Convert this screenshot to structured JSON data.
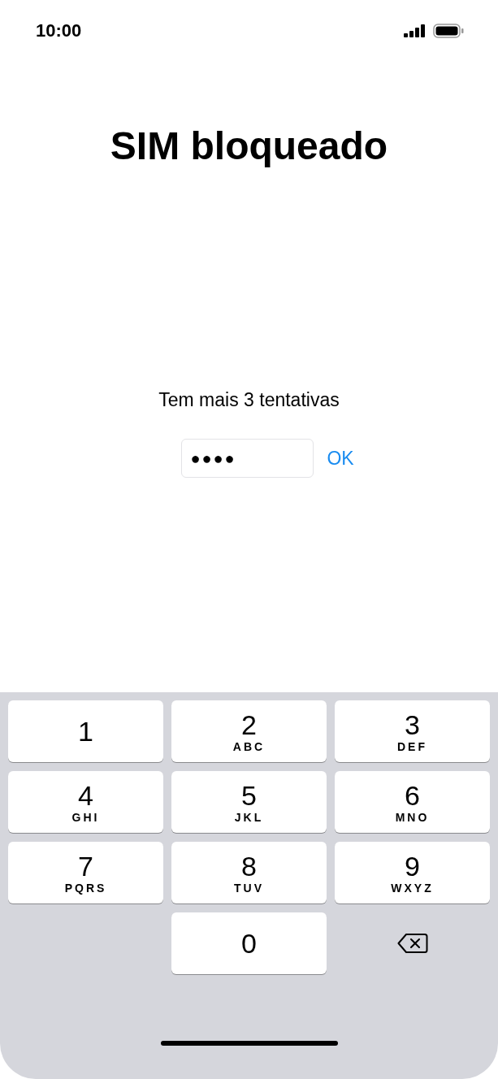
{
  "status_bar": {
    "time": "10:00"
  },
  "title": "SIM bloqueado",
  "message": "Tem mais 3 tentativas",
  "pin_field": {
    "value": "●●●●"
  },
  "ok_button": "OK",
  "keypad": [
    {
      "kind": "digit",
      "digit": "1"
    },
    {
      "kind": "digit",
      "digit": "2",
      "letters": "ABC"
    },
    {
      "kind": "digit",
      "digit": "3",
      "letters": "DEF"
    },
    {
      "kind": "digit",
      "digit": "4",
      "letters": "GHI"
    },
    {
      "kind": "digit",
      "digit": "5",
      "letters": "JKL"
    },
    {
      "kind": "digit",
      "digit": "6",
      "letters": "MNO"
    },
    {
      "kind": "digit",
      "digit": "7",
      "letters": "PQRS"
    },
    {
      "kind": "digit",
      "digit": "8",
      "letters": "TUV"
    },
    {
      "kind": "digit",
      "digit": "9",
      "letters": "WXYZ"
    },
    {
      "kind": "blank"
    },
    {
      "kind": "digit",
      "digit": "0"
    },
    {
      "kind": "backspace"
    }
  ]
}
